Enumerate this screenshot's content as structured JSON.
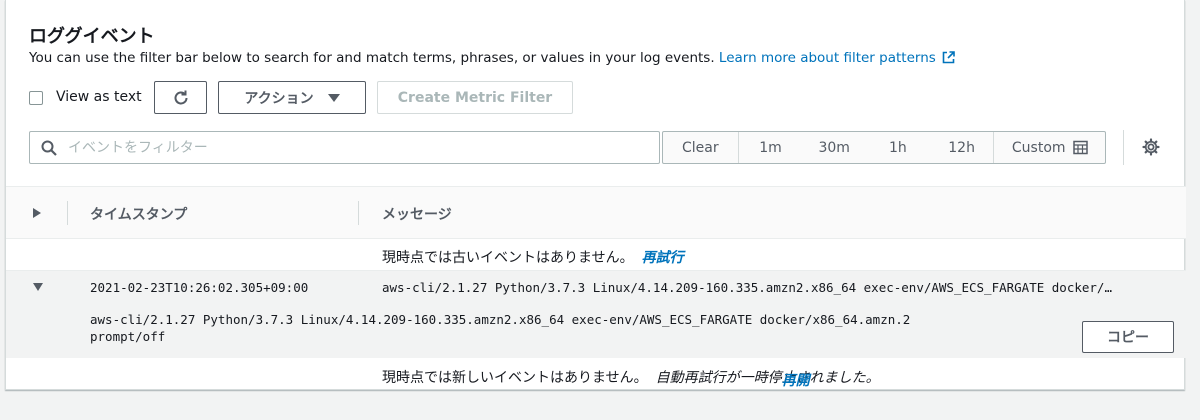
{
  "header": {
    "title": "ロググイベント",
    "description": "You can use the filter bar below to search for and match terms, phrases, or values in your log events.",
    "learn_more": "Learn more about filter patterns"
  },
  "toolbar": {
    "view_as_text": "View as text",
    "actions_label": "アクション",
    "create_metric_filter": "Create Metric Filter"
  },
  "search": {
    "placeholder": "イベントをフィルター",
    "value": ""
  },
  "time_range": {
    "clear": "Clear",
    "options": [
      "1m",
      "30m",
      "1h",
      "12h"
    ],
    "custom": "Custom"
  },
  "table": {
    "col_timestamp": "タイムスタンプ",
    "col_message": "メッセージ"
  },
  "older_events": {
    "text": "現時点では古いイベントはありません。",
    "retry": "再試行"
  },
  "event": {
    "timestamp": "2021-02-23T10:26:02.305+09:00",
    "message": "aws-cli/2.1.27 Python/3.7.3 Linux/4.14.209-160.335.amzn2.x86_64 exec-env/AWS_ECS_FARGATE docker/…",
    "detail": "aws-cli/2.1.27 Python/3.7.3 Linux/4.14.209-160.335.amzn2.x86_64 exec-env/AWS_ECS_FARGATE docker/x86_64.amzn.2\nprompt/off",
    "copy": "コピー"
  },
  "newer_events": {
    "text": "現時点では新しいイベントはありません。",
    "paused": "自動再試行が一時停止されました。",
    "resume": "再開"
  },
  "colors": {
    "link": "#0073bb",
    "text": "#16191f",
    "muted": "#545b64",
    "disabled": "#aab7b8",
    "background": "#f2f3f3"
  }
}
